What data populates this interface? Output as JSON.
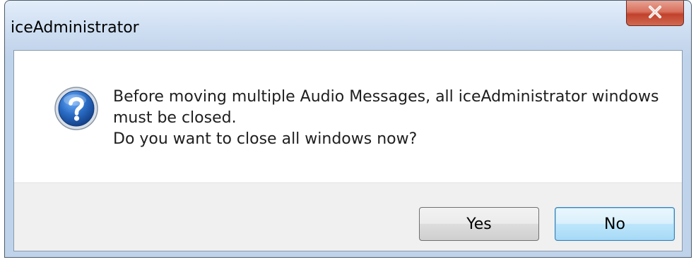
{
  "window": {
    "title": "iceAdministrator"
  },
  "message": {
    "icon": "question-icon",
    "lines": [
      "Before moving multiple Audio Messages, all iceAdministrator windows",
      "must be closed.",
      "Do you want to close all windows now?"
    ]
  },
  "buttons": {
    "yes_label": "Yes",
    "no_label": "No"
  },
  "colors": {
    "close_button": "#c7473a",
    "icon_blue": "#1f5fae",
    "default_button_border": "#3c7fb1"
  }
}
